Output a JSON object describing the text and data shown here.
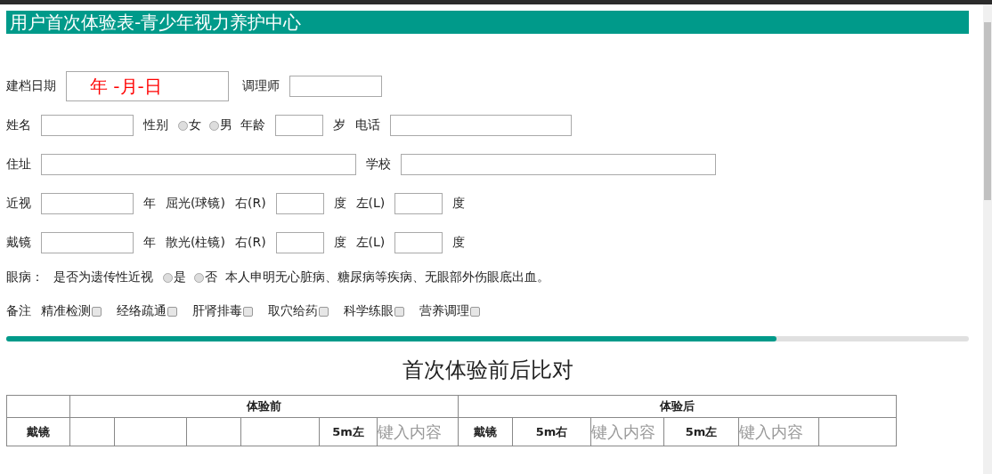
{
  "title": "用户首次体验表-青少年视力养护中心",
  "form_rows": [
    {
      "items": [
        {
          "kind": "label",
          "text": "建档日期"
        },
        {
          "kind": "date-field",
          "value": "年 -月-日"
        },
        {
          "kind": "label",
          "text": "调理师"
        },
        {
          "kind": "field"
        }
      ]
    },
    {
      "items": [
        {
          "kind": "label",
          "text": "姓名"
        },
        {
          "kind": "field"
        },
        {
          "kind": "label",
          "text": "性别"
        },
        {
          "kind": "radio",
          "label": "女",
          "checked": false
        },
        {
          "kind": "radio",
          "label": "男",
          "checked": false
        },
        {
          "kind": "label",
          "text": "年龄"
        },
        {
          "kind": "short-field"
        },
        {
          "kind": "label",
          "text": "岁"
        },
        {
          "kind": "label",
          "text": "电话"
        },
        {
          "kind": "wide-field"
        }
      ]
    },
    {
      "items": [
        {
          "kind": "label",
          "text": "住址"
        },
        {
          "kind": "long-field"
        },
        {
          "kind": "label",
          "text": "学校"
        },
        {
          "kind": "long-field"
        }
      ]
    },
    {
      "items": [
        {
          "kind": "label",
          "text": "近视"
        },
        {
          "kind": "field"
        },
        {
          "kind": "label",
          "text": "年"
        },
        {
          "kind": "label",
          "text": "屈光(球镜)"
        },
        {
          "kind": "label",
          "text": "右(R)"
        },
        {
          "kind": "short-field"
        },
        {
          "kind": "label",
          "text": "度"
        },
        {
          "kind": "label",
          "text": "左(L)"
        },
        {
          "kind": "short-field"
        },
        {
          "kind": "label",
          "text": "度"
        }
      ]
    },
    {
      "items": [
        {
          "kind": "label",
          "text": "戴镜"
        },
        {
          "kind": "field"
        },
        {
          "kind": "label",
          "text": "年"
        },
        {
          "kind": "label",
          "text": "散光(柱镜)"
        },
        {
          "kind": "label",
          "text": "右(R)"
        },
        {
          "kind": "short-field"
        },
        {
          "kind": "label",
          "text": "度"
        },
        {
          "kind": "label",
          "text": "左(L)"
        },
        {
          "kind": "short-field"
        },
        {
          "kind": "label",
          "text": "度"
        }
      ]
    },
    {
      "items": [
        {
          "kind": "label",
          "text": "眼病："
        },
        {
          "kind": "label",
          "text": "是否为遗传性近视"
        },
        {
          "kind": "radio",
          "label": "是",
          "checked": false
        },
        {
          "kind": "radio",
          "label": "否",
          "checked": false
        },
        {
          "kind": "label",
          "text": "本人申明无心脏病、糖尿病等疾病、无眼部外伤眼底出血。"
        }
      ]
    },
    {
      "items": [
        {
          "kind": "label",
          "text": "备注"
        },
        {
          "kind": "checkbox",
          "label": "精准检测",
          "checked": false
        },
        {
          "kind": "checkbox",
          "label": "经络疏通",
          "checked": false
        },
        {
          "kind": "checkbox",
          "label": "肝肾排毒",
          "checked": false
        },
        {
          "kind": "checkbox",
          "label": "取穴给药",
          "checked": false
        },
        {
          "kind": "checkbox",
          "label": "科学练眼",
          "checked": false
        },
        {
          "kind": "checkbox",
          "label": "营养调理",
          "checked": false
        }
      ]
    }
  ],
  "progress": {
    "level": 0.8
  },
  "heading": "首次体验前后比对",
  "table": {
    "groups": [
      {
        "label": "体验前"
      },
      {
        "label": "体验后"
      }
    ],
    "row_2": [
      {
        "kind": "head",
        "text": "戴镜"
      },
      {
        "kind": "blank"
      },
      {
        "kind": "blank"
      },
      {
        "kind": "blank"
      },
      {
        "kind": "blank"
      },
      {
        "kind": "head",
        "text": "5m左"
      },
      {
        "kind": "input",
        "placeholder": "键入内容"
      },
      {
        "kind": "head",
        "text": "戴镜"
      },
      {
        "kind": "head",
        "text": "5m右"
      },
      {
        "kind": "input",
        "placeholder": "键入内容"
      },
      {
        "kind": "head",
        "text": "5m左"
      },
      {
        "kind": "input",
        "placeholder": "键入内容"
      },
      {
        "kind": "blank"
      }
    ]
  }
}
